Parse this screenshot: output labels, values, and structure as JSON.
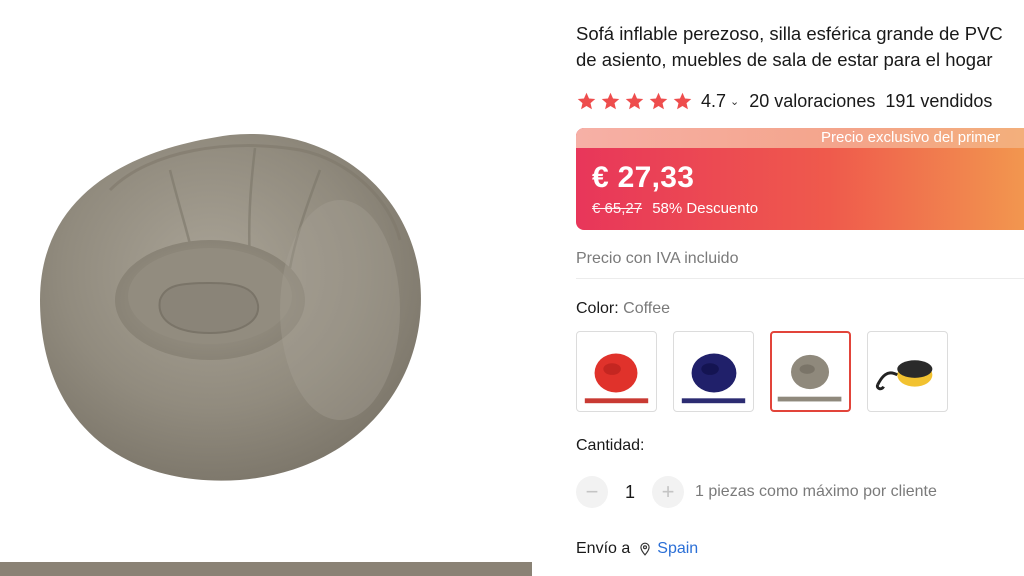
{
  "product": {
    "title_line1": "Sofá inflable perezoso, silla esférica grande de PVC",
    "title_line2": "de asiento, muebles de sala de estar para el hogar",
    "rating": "4.7",
    "stars_filled": 5,
    "reviews": "20 valoraciones",
    "sold": "191 vendidos"
  },
  "price": {
    "banner": "Precio exclusivo del primer",
    "current": "€ 27,33",
    "original": "€ 65,27",
    "discount": "58% Descuento",
    "vat_note": "Precio con IVA incluido"
  },
  "color": {
    "label": "Color:",
    "selected": "Coffee",
    "options": [
      "red",
      "navy",
      "coffee",
      "foot-pump"
    ]
  },
  "quantity": {
    "label": "Cantidad:",
    "minus": "−",
    "value": "1",
    "plus": "+",
    "note": "1 piezas como máximo por cliente"
  },
  "shipping": {
    "label": "Envío a",
    "destination": "Spain"
  },
  "icons": {
    "star": "star-icon",
    "chevron": "chevron-down-icon",
    "location": "location-pin-icon"
  },
  "colors": {
    "star": "#ee4d4d",
    "price_gradient_start": "#e8365a",
    "price_gradient_end": "#f29a4f",
    "selected_border": "#e2443a",
    "link": "#2b6fd6"
  }
}
